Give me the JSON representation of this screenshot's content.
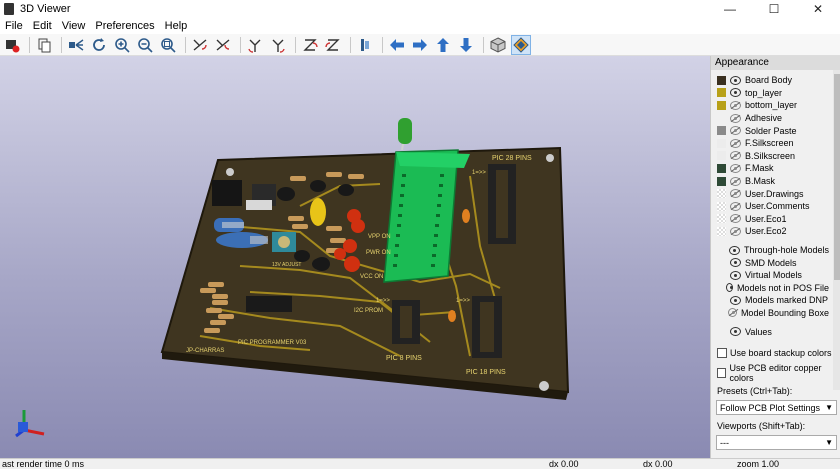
{
  "window": {
    "title": "3D Viewer",
    "controls": [
      "—",
      "☐",
      "✕"
    ]
  },
  "menu": [
    "File",
    "Edit",
    "View",
    "Preferences",
    "Help"
  ],
  "toolbar_icons": [
    "render-options-icon",
    "copy-icon",
    "toggle-view-icon",
    "reload-icon",
    "zoom-in-icon",
    "zoom-out-icon",
    "zoom-fit-icon",
    "rotate-x-cw-icon",
    "rotate-x-ccw-icon",
    "rotate-y-cw-icon",
    "rotate-y-ccw-icon",
    "rotate-z-cw-icon",
    "rotate-z-ccw-icon",
    "flip-board-icon",
    "pan-left-icon",
    "pan-right-icon",
    "pan-up-icon",
    "pan-down-icon",
    "orthographic-icon",
    "raytrace-icon"
  ],
  "appearance": {
    "header": "Appearance",
    "layers": [
      {
        "name": "Board Body",
        "color": "#3a3020",
        "visible": true
      },
      {
        "name": "top_layer",
        "color": "#b8a118",
        "visible": true
      },
      {
        "name": "bottom_layer",
        "color": "#b8a118",
        "visible": false
      },
      {
        "name": "Adhesive",
        "color": "",
        "visible": false
      },
      {
        "name": "Solder Paste",
        "color": "#8a8a8a",
        "visible": false
      },
      {
        "name": "F.Silkscreen",
        "color": "#ececec",
        "visible": false
      },
      {
        "name": "B.Silkscreen",
        "color": "#ececec",
        "visible": false
      },
      {
        "name": "F.Mask",
        "color": "#2e4a36",
        "visible": false
      },
      {
        "name": "B.Mask",
        "color": "#2e4a36",
        "visible": false
      },
      {
        "name": "User.Drawings",
        "color": "checker",
        "visible": false
      },
      {
        "name": "User.Comments",
        "color": "checker",
        "visible": false
      },
      {
        "name": "User.Eco1",
        "color": "checker",
        "visible": false
      },
      {
        "name": "User.Eco2",
        "color": "checker",
        "visible": false
      }
    ],
    "models": [
      {
        "name": "Through-hole Models",
        "visible": true
      },
      {
        "name": "SMD Models",
        "visible": true
      },
      {
        "name": "Virtual Models",
        "visible": true
      },
      {
        "name": "Models not in POS File",
        "visible": true
      },
      {
        "name": "Models marked DNP",
        "visible": true
      },
      {
        "name": "Model Bounding Boxe",
        "visible": false
      }
    ],
    "values": {
      "name": "Values",
      "visible": true
    },
    "stackup_checkbox": "Use board stackup colors",
    "copper_checkbox": "Use PCB editor copper colors",
    "presets_label": "Presets (Ctrl+Tab):",
    "presets_value": "Follow PCB Plot Settings",
    "viewports_label": "Viewports (Shift+Tab):",
    "viewports_value": "---"
  },
  "board": {
    "silk": [
      "PIC 28 PINS",
      "1=>>",
      "1=>>",
      "1=>>",
      "VPP ON",
      "PWR ON",
      "VCC ON",
      "13V ADJUST",
      "I2C PROM",
      "PIC 8 PINS",
      "PIC 18 PINS",
      "PIC PROGRAMMER V03",
      "JP-CHARRAS"
    ]
  },
  "status": {
    "render_time": "ast render time 0 ms",
    "dx1": "dx 0.00",
    "dx2": "dx 0.00",
    "zoom": "zoom 1.00"
  }
}
